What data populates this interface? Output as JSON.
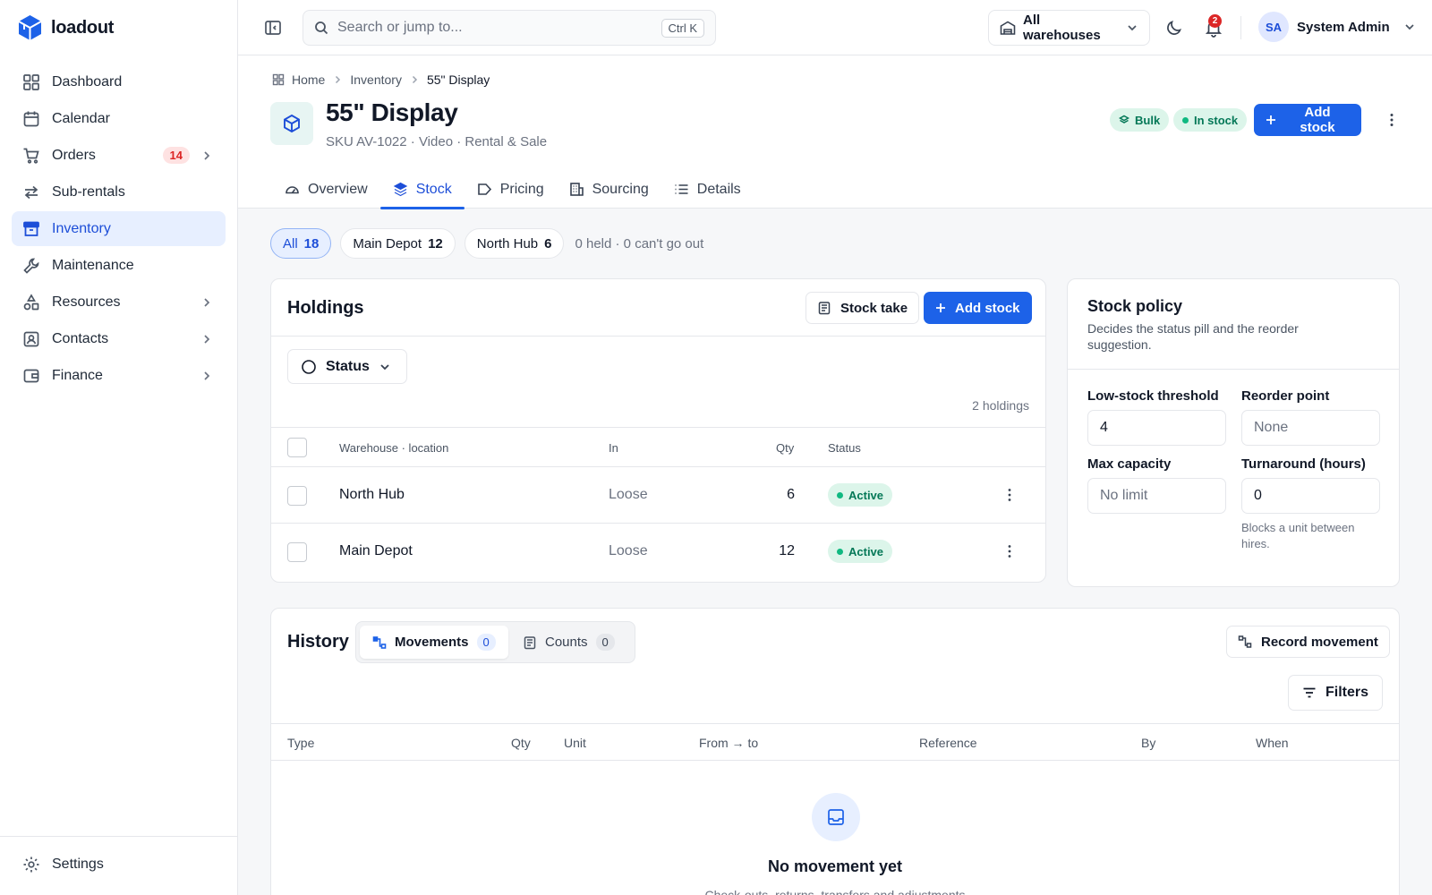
{
  "brand": {
    "name": "loadout",
    "accent": "#1d62e8"
  },
  "sidebar": {
    "items": [
      {
        "label": "Dashboard",
        "icon": "grid-icon"
      },
      {
        "label": "Calendar",
        "icon": "calendar-icon"
      },
      {
        "label": "Orders",
        "icon": "cart-icon",
        "badge": "14"
      },
      {
        "label": "Sub-rentals",
        "icon": "arrows-icon"
      },
      {
        "label": "Inventory",
        "icon": "archive-icon",
        "active": true
      },
      {
        "label": "Maintenance",
        "icon": "wrench-icon"
      },
      {
        "label": "Resources",
        "icon": "shapes-icon"
      },
      {
        "label": "Contacts",
        "icon": "contacts-icon"
      },
      {
        "label": "Finance",
        "icon": "wallet-icon"
      }
    ],
    "settings_label": "Settings"
  },
  "topbar": {
    "search_placeholder": "Search or jump to...",
    "search_shortcut": "Ctrl K",
    "warehouse_select": "All warehouses",
    "notifications_count": "2",
    "user_initials": "SA",
    "user_name": "System Admin"
  },
  "breadcrumb": {
    "home": "Home",
    "section": "Inventory",
    "current": "55\" Display"
  },
  "product": {
    "title": "55\" Display",
    "subtitle": "SKU AV-1022 · Video · Rental & Sale",
    "pill_bulk": "Bulk",
    "pill_stock": "In stock",
    "add_stock_label": "Add stock"
  },
  "tabs": [
    {
      "label": "Overview"
    },
    {
      "label": "Stock",
      "active": true
    },
    {
      "label": "Pricing"
    },
    {
      "label": "Sourcing"
    },
    {
      "label": "Details"
    }
  ],
  "filters": {
    "all": {
      "label": "All",
      "count": "18"
    },
    "main_depot": {
      "label": "Main Depot",
      "count": "12"
    },
    "north_hub": {
      "label": "North Hub",
      "count": "6"
    },
    "note": "0 held · 0 can't go out"
  },
  "holdings": {
    "title": "Holdings",
    "stock_take_label": "Stock take",
    "add_stock_label": "Add stock",
    "status_filter_label": "Status",
    "count_note": "2 holdings",
    "columns": {
      "location": "Warehouse · location",
      "in": "In",
      "qty": "Qty",
      "status": "Status"
    },
    "rows": [
      {
        "location": "North Hub",
        "in": "Loose",
        "qty": "6",
        "status": "Active"
      },
      {
        "location": "Main Depot",
        "in": "Loose",
        "qty": "12",
        "status": "Active"
      }
    ]
  },
  "policy": {
    "title": "Stock policy",
    "description": "Decides the status pill and the reorder suggestion.",
    "low_stock_label": "Low-stock threshold",
    "low_stock_value": "4",
    "reorder_label": "Reorder point",
    "reorder_placeholder": "None",
    "max_capacity_label": "Max capacity",
    "max_capacity_placeholder": "No limit",
    "turnaround_label": "Turnaround (hours)",
    "turnaround_value": "0",
    "turnaround_help": "Blocks a unit between hires."
  },
  "history": {
    "title": "History",
    "movements_label": "Movements",
    "movements_count": "0",
    "counts_label": "Counts",
    "counts_count": "0",
    "record_label": "Record movement",
    "filters_label": "Filters",
    "columns": {
      "type": "Type",
      "qty": "Qty",
      "unit": "Unit",
      "from_to": "From → to",
      "reference": "Reference",
      "by": "By",
      "when": "When"
    },
    "empty_title": "No movement yet",
    "empty_desc": "Check-outs, returns, transfers and adjustments"
  }
}
